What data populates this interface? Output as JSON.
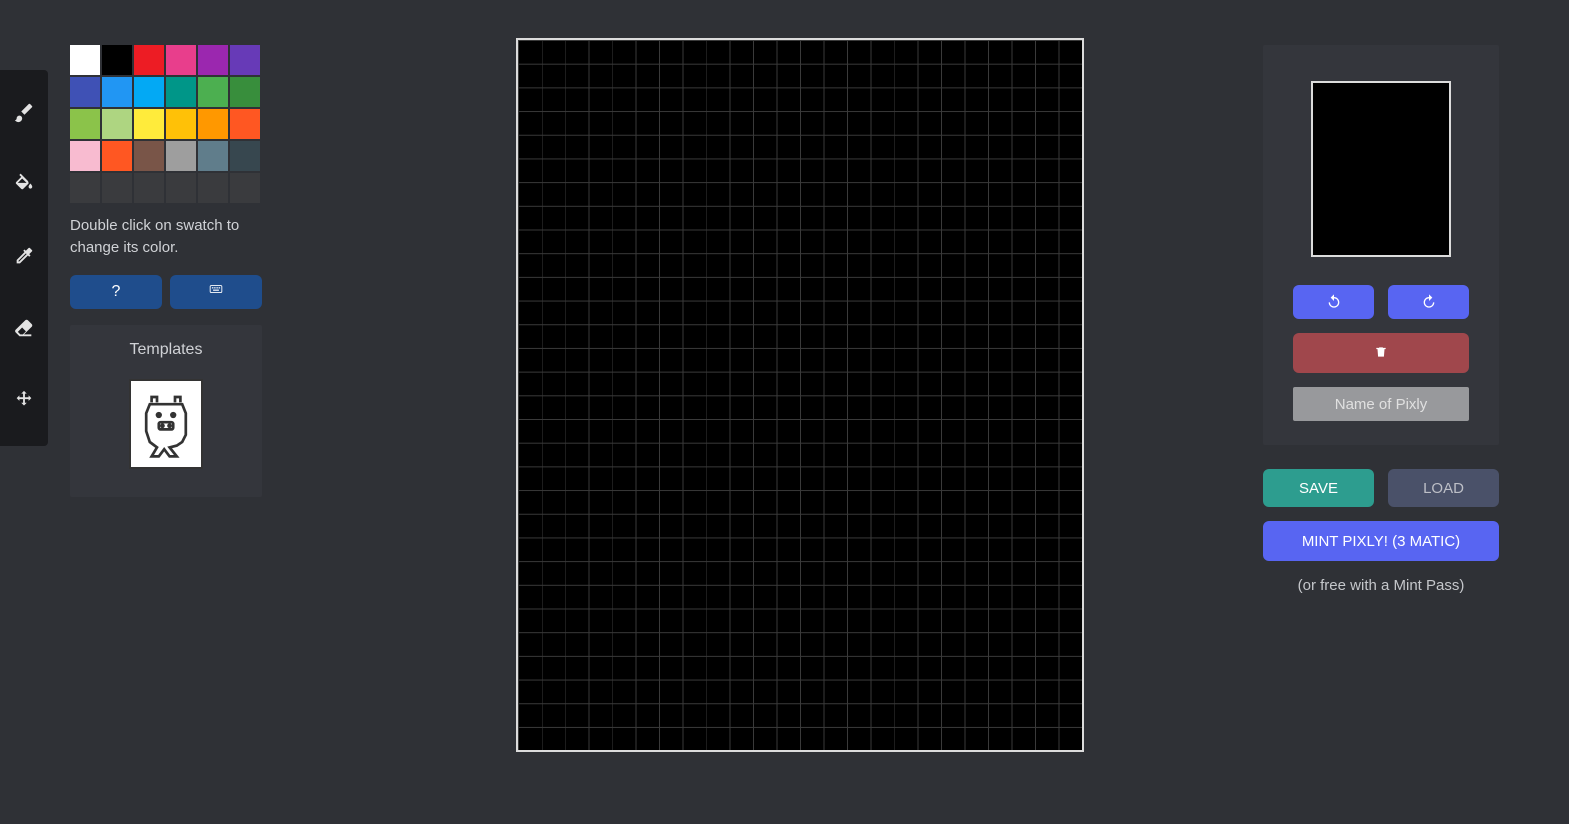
{
  "tools": {
    "brush": "brush",
    "fill": "fill",
    "eyedropper": "eyedropper",
    "eraser": "eraser",
    "move": "move"
  },
  "palette": {
    "swatches": [
      "#ffffff",
      "#000000",
      "#ed1c24",
      "#e83e8c",
      "#9b27af",
      "#673ab7",
      "#3f51b5",
      "#2196f3",
      "#03a9f4",
      "#009688",
      "#4caf50",
      "#388e3c",
      "#8bc34a",
      "#aed581",
      "#ffeb3b",
      "#ffc107",
      "#ff9800",
      "#ff5722",
      "#f8bbd0",
      "#ff5722",
      "#795548",
      "#9e9e9e",
      "#607d8b",
      "#37474f",
      "#3a3b3e",
      "#3a3b3e",
      "#3a3b3e",
      "#3a3b3e",
      "#3a3b3e",
      "#3a3b3e"
    ],
    "hint": "Double click on swatch to change its color.",
    "help_label": "?",
    "keyboard_label": "⌨"
  },
  "templates": {
    "title": "Templates"
  },
  "canvas": {
    "cols": 24,
    "rows": 30
  },
  "right": {
    "name_placeholder": "Name of Pixly",
    "save_label": "SAVE",
    "load_label": "LOAD",
    "mint_label": "MINT PIXLY! (3 MATIC)",
    "mint_note": "(or free with a Mint Pass)"
  }
}
